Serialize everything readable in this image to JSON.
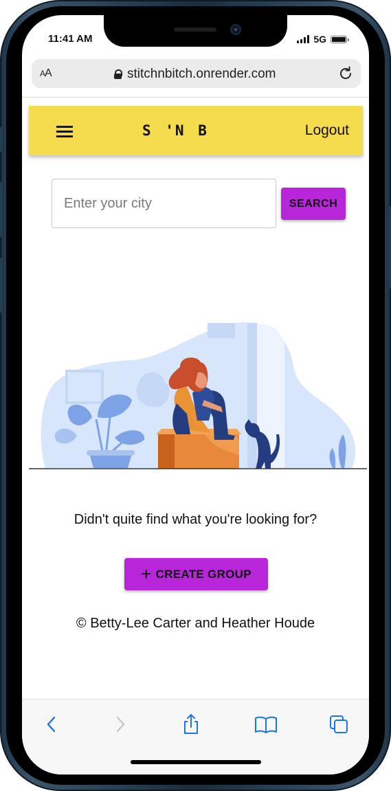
{
  "status": {
    "time": "11:41 AM",
    "network": "5G"
  },
  "browser": {
    "text_size_label_small": "A",
    "text_size_label_large": "A",
    "url": "stitchnbitch.onrender.com"
  },
  "navbar": {
    "brand": "S 'N B",
    "logout_label": "Logout"
  },
  "search": {
    "placeholder": "Enter your city",
    "value": "",
    "button_label": "SEARCH"
  },
  "empty_state": {
    "message": "Didn't quite find what you're looking for?",
    "create_label": "CREATE GROUP",
    "create_icon": "plus-icon"
  },
  "footer": {
    "copyright_symbol": "©",
    "credit": "Betty-Lee Carter and Heather Houde"
  },
  "colors": {
    "navbar_bg": "#f4dc4e",
    "accent": "#b726d9",
    "toolbar_icon": "#1a73e8"
  },
  "toolbar": {
    "icons": [
      "back-icon",
      "forward-icon",
      "share-icon",
      "bookmarks-icon",
      "tabs-icon"
    ]
  }
}
